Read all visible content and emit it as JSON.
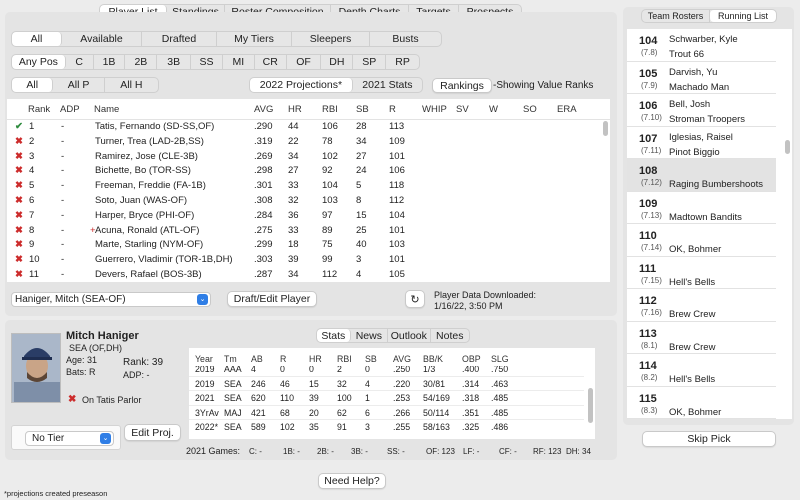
{
  "top_tabs": [
    "Player List",
    "Standings",
    "Roster Composition",
    "Depth Charts",
    "Targets",
    "Prospects"
  ],
  "status_tabs": [
    "All",
    "Available",
    "Drafted",
    "My Tiers",
    "Sleepers",
    "Busts"
  ],
  "pos_tabs": [
    "Any Pos",
    "C",
    "1B",
    "2B",
    "3B",
    "SS",
    "MI",
    "CR",
    "OF",
    "DH",
    "SP",
    "RP"
  ],
  "type_tabs": [
    "All",
    "All P",
    "All H"
  ],
  "proj_tabs": [
    "2022 Projections*",
    "2021 Stats"
  ],
  "rankings_btn": "Rankings",
  "showing_text": "-Showing Value Ranks",
  "columns": [
    "Rank",
    "ADP",
    "Name",
    "AVG",
    "HR",
    "RBI",
    "SB",
    "R",
    "WHIP",
    "SV",
    "W",
    "SO",
    "ERA"
  ],
  "players": [
    {
      "mark": "✔",
      "mark_type": "check",
      "rank": "1",
      "adp": "-",
      "name": "Tatis, Fernando (SD-SS,OF)",
      "avg": ".290",
      "hr": "44",
      "rbi": "106",
      "sb": "28",
      "r": "113"
    },
    {
      "mark": "✖",
      "mark_type": "cross",
      "rank": "2",
      "adp": "-",
      "name": "Turner, Trea (LAD-2B,SS)",
      "avg": ".319",
      "hr": "22",
      "rbi": "78",
      "sb": "34",
      "r": "109"
    },
    {
      "mark": "✖",
      "mark_type": "cross",
      "rank": "3",
      "adp": "-",
      "name": "Ramirez, Jose (CLE-3B)",
      "avg": ".269",
      "hr": "34",
      "rbi": "102",
      "sb": "27",
      "r": "101"
    },
    {
      "mark": "✖",
      "mark_type": "cross",
      "rank": "4",
      "adp": "-",
      "name": "Bichette, Bo (TOR-SS)",
      "avg": ".298",
      "hr": "27",
      "rbi": "92",
      "sb": "24",
      "r": "106"
    },
    {
      "mark": "✖",
      "mark_type": "cross",
      "rank": "5",
      "adp": "-",
      "name": "Freeman, Freddie (FA-1B)",
      "avg": ".301",
      "hr": "33",
      "rbi": "104",
      "sb": "5",
      "r": "118"
    },
    {
      "mark": "✖",
      "mark_type": "cross",
      "rank": "6",
      "adp": "-",
      "name": "Soto, Juan (WAS-OF)",
      "avg": ".308",
      "hr": "32",
      "rbi": "103",
      "sb": "8",
      "r": "112"
    },
    {
      "mark": "✖",
      "mark_type": "cross",
      "rank": "7",
      "adp": "-",
      "name": "Harper, Bryce (PHI-OF)",
      "avg": ".284",
      "hr": "36",
      "rbi": "97",
      "sb": "15",
      "r": "104"
    },
    {
      "mark": "✖",
      "mark_type": "cross",
      "rank": "8",
      "adp": "-",
      "name": "Acuna, Ronald (ATL-OF)",
      "prefix": "+",
      "avg": ".275",
      "hr": "33",
      "rbi": "89",
      "sb": "25",
      "r": "101"
    },
    {
      "mark": "✖",
      "mark_type": "cross",
      "rank": "9",
      "adp": "-",
      "name": "Marte, Starling (NYM-OF)",
      "avg": ".299",
      "hr": "18",
      "rbi": "75",
      "sb": "40",
      "r": "103"
    },
    {
      "mark": "✖",
      "mark_type": "cross",
      "rank": "10",
      "adp": "-",
      "name": "Guerrero, Vladimir (TOR-1B,DH)",
      "avg": ".303",
      "hr": "39",
      "rbi": "99",
      "sb": "3",
      "r": "101"
    },
    {
      "mark": "✖",
      "mark_type": "cross",
      "rank": "11",
      "adp": "-",
      "name": "Devers, Rafael (BOS-3B)",
      "avg": ".287",
      "hr": "34",
      "rbi": "112",
      "sb": "4",
      "r": "105"
    }
  ],
  "player_select": "Haniger, Mitch (SEA-OF)",
  "draft_btn": "Draft/Edit Player",
  "downloaded_label": "Player Data Downloaded:",
  "downloaded_time": "1/16/22, 3:50 PM",
  "detail": {
    "name": "Mitch Haniger",
    "pos": "SEA (OF,DH)",
    "age": "Age: 31",
    "bats": "Bats: R",
    "rank": "Rank: 39",
    "adp": "ADP: -",
    "team": "On Tatis Parlor",
    "tier": "No Tier",
    "edit_proj": "Edit Proj."
  },
  "detail_tabs": [
    "Stats",
    "News",
    "Outlook",
    "Notes"
  ],
  "stats_columns": [
    "Year",
    "Tm",
    "AB",
    "R",
    "HR",
    "RBI",
    "SB",
    "AVG",
    "BB/K",
    "OBP",
    "SLG"
  ],
  "stats_rows": [
    [
      "2019",
      "AAA",
      "4",
      "0",
      "0",
      "2",
      "0",
      ".250",
      "1/3",
      ".400",
      ".750"
    ],
    [
      "2019",
      "SEA",
      "246",
      "46",
      "15",
      "32",
      "4",
      ".220",
      "30/81",
      ".314",
      ".463"
    ],
    [
      "2021",
      "SEA",
      "620",
      "110",
      "39",
      "100",
      "1",
      ".253",
      "54/169",
      ".318",
      ".485"
    ],
    [
      "3YrAv",
      "MAJ",
      "421",
      "68",
      "20",
      "62",
      "6",
      ".266",
      "50/114",
      ".351",
      ".485"
    ],
    [
      "2022*",
      "SEA",
      "589",
      "102",
      "35",
      "91",
      "3",
      ".255",
      "58/163",
      ".325",
      ".486"
    ]
  ],
  "games_label": "2021 Games:",
  "games": [
    "C: -",
    "1B: -",
    "2B: -",
    "3B: -",
    "SS: -",
    "OF: 123",
    "LF: -",
    "CF: -",
    "RF: 123",
    "DH: 34"
  ],
  "need_help": "Need Help?",
  "footnote": "*projections created preseason",
  "side_tabs": [
    "Team Rosters",
    "Running List"
  ],
  "picks": [
    {
      "num": "104",
      "adp": "(7.8)",
      "t1": "Schwarber, Kyle",
      "t2": "Trout 66"
    },
    {
      "num": "105",
      "adp": "(7.9)",
      "t1": "Darvish, Yu",
      "t2": "Machado Man"
    },
    {
      "num": "106",
      "adp": "(7.10)",
      "t1": "Bell, Josh",
      "t2": "Stroman Troopers"
    },
    {
      "num": "107",
      "adp": "(7.11)",
      "t1": "Iglesias, Raisel",
      "t2": "Pinot Biggio"
    },
    {
      "num": "108",
      "adp": "(7.12)",
      "t1": "",
      "t2": "Raging Bumbershoots"
    },
    {
      "num": "109",
      "adp": "(7.13)",
      "t1": "",
      "t2": "Madtown Bandits"
    },
    {
      "num": "110",
      "adp": "(7.14)",
      "t1": "",
      "t2": "OK, Bohmer"
    },
    {
      "num": "111",
      "adp": "(7.15)",
      "t1": "",
      "t2": "Hell's Bells"
    },
    {
      "num": "112",
      "adp": "(7.16)",
      "t1": "",
      "t2": "Brew Crew"
    },
    {
      "num": "113",
      "adp": "(8.1)",
      "t1": "",
      "t2": "Brew Crew"
    },
    {
      "num": "114",
      "adp": "(8.2)",
      "t1": "",
      "t2": "Hell's Bells"
    },
    {
      "num": "115",
      "adp": "(8.3)",
      "t1": "",
      "t2": "OK, Bohmer"
    }
  ],
  "skip_pick": "Skip Pick",
  "colors": {
    "check": "#2e8b3e",
    "cross": "#cc2b2b",
    "highlight": "#e3e3e3",
    "select_blue": "#2f7ee6"
  }
}
